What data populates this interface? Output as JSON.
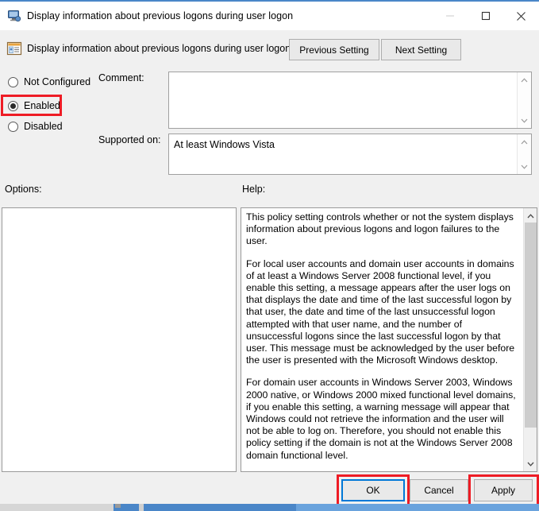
{
  "window": {
    "title": "Display information about previous logons during user logon",
    "title_icon": "computer-monitor-icon",
    "minimize_label": "—",
    "maximize_label": "□",
    "close_label": "✕"
  },
  "header": {
    "icon": "policy-setting-icon",
    "title": "Display information about previous logons during user logon",
    "previous_setting_label": "Previous Setting",
    "next_setting_label": "Next Setting"
  },
  "state_options": {
    "not_configured_label": "Not Configured",
    "enabled_label": "Enabled",
    "disabled_label": "Disabled",
    "selected": "Enabled"
  },
  "comment": {
    "label": "Comment:",
    "value": "",
    "placeholder": ""
  },
  "supported_on": {
    "label": "Supported on:",
    "value": "At least Windows Vista"
  },
  "options": {
    "label": "Options:",
    "value": ""
  },
  "help": {
    "label": "Help:",
    "paragraphs": [
      "This policy setting controls whether or not the system displays information about previous logons and logon failures to the user.",
      "For local user accounts and domain user accounts in domains of at least a Windows Server 2008 functional level, if you enable this setting, a message appears after the user logs on that displays the date and time of the last successful logon by that user, the date and time of the last unsuccessful logon attempted with that user name, and the number of unsuccessful logons since the last successful logon by that user. This message must be acknowledged by the user before the user is presented with the Microsoft Windows desktop.",
      "For domain user accounts in Windows Server 2003, Windows 2000 native, or Windows 2000 mixed functional level domains, if you enable this setting, a warning message will appear that Windows could not retrieve the information and the user will not be able to log on. Therefore, you should not enable this policy setting if the domain is not at the Windows Server 2008 domain functional level."
    ]
  },
  "footer": {
    "ok_label": "OK",
    "cancel_label": "Cancel",
    "apply_label": "Apply"
  },
  "annotations": {
    "highlight_color": "#ee1c25",
    "focus_color": "#0078d7",
    "highlighted": [
      "Enabled",
      "OK",
      "Apply"
    ]
  }
}
